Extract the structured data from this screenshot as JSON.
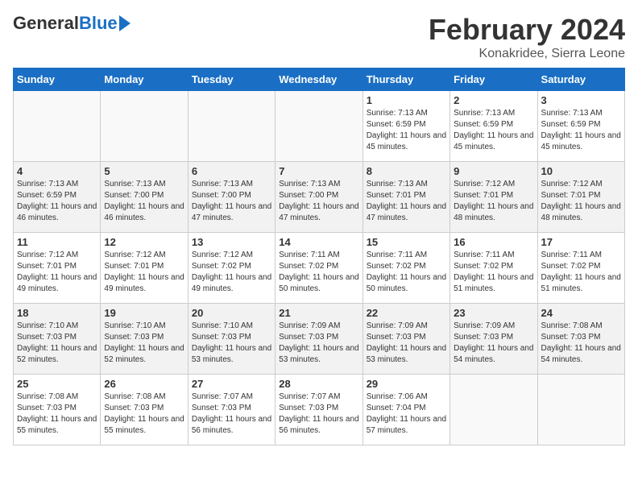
{
  "header": {
    "logo_general": "General",
    "logo_blue": "Blue",
    "month_title": "February 2024",
    "location": "Konakridee, Sierra Leone"
  },
  "weekdays": [
    "Sunday",
    "Monday",
    "Tuesday",
    "Wednesday",
    "Thursday",
    "Friday",
    "Saturday"
  ],
  "weeks": [
    [
      {
        "day": "",
        "empty": true
      },
      {
        "day": "",
        "empty": true
      },
      {
        "day": "",
        "empty": true
      },
      {
        "day": "",
        "empty": true
      },
      {
        "day": "1",
        "sunrise": "7:13 AM",
        "sunset": "6:59 PM",
        "daylight": "11 hours and 45 minutes."
      },
      {
        "day": "2",
        "sunrise": "7:13 AM",
        "sunset": "6:59 PM",
        "daylight": "11 hours and 45 minutes."
      },
      {
        "day": "3",
        "sunrise": "7:13 AM",
        "sunset": "6:59 PM",
        "daylight": "11 hours and 45 minutes."
      }
    ],
    [
      {
        "day": "4",
        "sunrise": "7:13 AM",
        "sunset": "6:59 PM",
        "daylight": "11 hours and 46 minutes."
      },
      {
        "day": "5",
        "sunrise": "7:13 AM",
        "sunset": "7:00 PM",
        "daylight": "11 hours and 46 minutes."
      },
      {
        "day": "6",
        "sunrise": "7:13 AM",
        "sunset": "7:00 PM",
        "daylight": "11 hours and 47 minutes."
      },
      {
        "day": "7",
        "sunrise": "7:13 AM",
        "sunset": "7:00 PM",
        "daylight": "11 hours and 47 minutes."
      },
      {
        "day": "8",
        "sunrise": "7:13 AM",
        "sunset": "7:01 PM",
        "daylight": "11 hours and 47 minutes."
      },
      {
        "day": "9",
        "sunrise": "7:12 AM",
        "sunset": "7:01 PM",
        "daylight": "11 hours and 48 minutes."
      },
      {
        "day": "10",
        "sunrise": "7:12 AM",
        "sunset": "7:01 PM",
        "daylight": "11 hours and 48 minutes."
      }
    ],
    [
      {
        "day": "11",
        "sunrise": "7:12 AM",
        "sunset": "7:01 PM",
        "daylight": "11 hours and 49 minutes."
      },
      {
        "day": "12",
        "sunrise": "7:12 AM",
        "sunset": "7:01 PM",
        "daylight": "11 hours and 49 minutes."
      },
      {
        "day": "13",
        "sunrise": "7:12 AM",
        "sunset": "7:02 PM",
        "daylight": "11 hours and 49 minutes."
      },
      {
        "day": "14",
        "sunrise": "7:11 AM",
        "sunset": "7:02 PM",
        "daylight": "11 hours and 50 minutes."
      },
      {
        "day": "15",
        "sunrise": "7:11 AM",
        "sunset": "7:02 PM",
        "daylight": "11 hours and 50 minutes."
      },
      {
        "day": "16",
        "sunrise": "7:11 AM",
        "sunset": "7:02 PM",
        "daylight": "11 hours and 51 minutes."
      },
      {
        "day": "17",
        "sunrise": "7:11 AM",
        "sunset": "7:02 PM",
        "daylight": "11 hours and 51 minutes."
      }
    ],
    [
      {
        "day": "18",
        "sunrise": "7:10 AM",
        "sunset": "7:03 PM",
        "daylight": "11 hours and 52 minutes."
      },
      {
        "day": "19",
        "sunrise": "7:10 AM",
        "sunset": "7:03 PM",
        "daylight": "11 hours and 52 minutes."
      },
      {
        "day": "20",
        "sunrise": "7:10 AM",
        "sunset": "7:03 PM",
        "daylight": "11 hours and 53 minutes."
      },
      {
        "day": "21",
        "sunrise": "7:09 AM",
        "sunset": "7:03 PM",
        "daylight": "11 hours and 53 minutes."
      },
      {
        "day": "22",
        "sunrise": "7:09 AM",
        "sunset": "7:03 PM",
        "daylight": "11 hours and 53 minutes."
      },
      {
        "day": "23",
        "sunrise": "7:09 AM",
        "sunset": "7:03 PM",
        "daylight": "11 hours and 54 minutes."
      },
      {
        "day": "24",
        "sunrise": "7:08 AM",
        "sunset": "7:03 PM",
        "daylight": "11 hours and 54 minutes."
      }
    ],
    [
      {
        "day": "25",
        "sunrise": "7:08 AM",
        "sunset": "7:03 PM",
        "daylight": "11 hours and 55 minutes."
      },
      {
        "day": "26",
        "sunrise": "7:08 AM",
        "sunset": "7:03 PM",
        "daylight": "11 hours and 55 minutes."
      },
      {
        "day": "27",
        "sunrise": "7:07 AM",
        "sunset": "7:03 PM",
        "daylight": "11 hours and 56 minutes."
      },
      {
        "day": "28",
        "sunrise": "7:07 AM",
        "sunset": "7:03 PM",
        "daylight": "11 hours and 56 minutes."
      },
      {
        "day": "29",
        "sunrise": "7:06 AM",
        "sunset": "7:04 PM",
        "daylight": "11 hours and 57 minutes."
      },
      {
        "day": "",
        "empty": true
      },
      {
        "day": "",
        "empty": true
      }
    ]
  ],
  "labels": {
    "sunrise": "Sunrise:",
    "sunset": "Sunset:",
    "daylight": "Daylight:"
  }
}
